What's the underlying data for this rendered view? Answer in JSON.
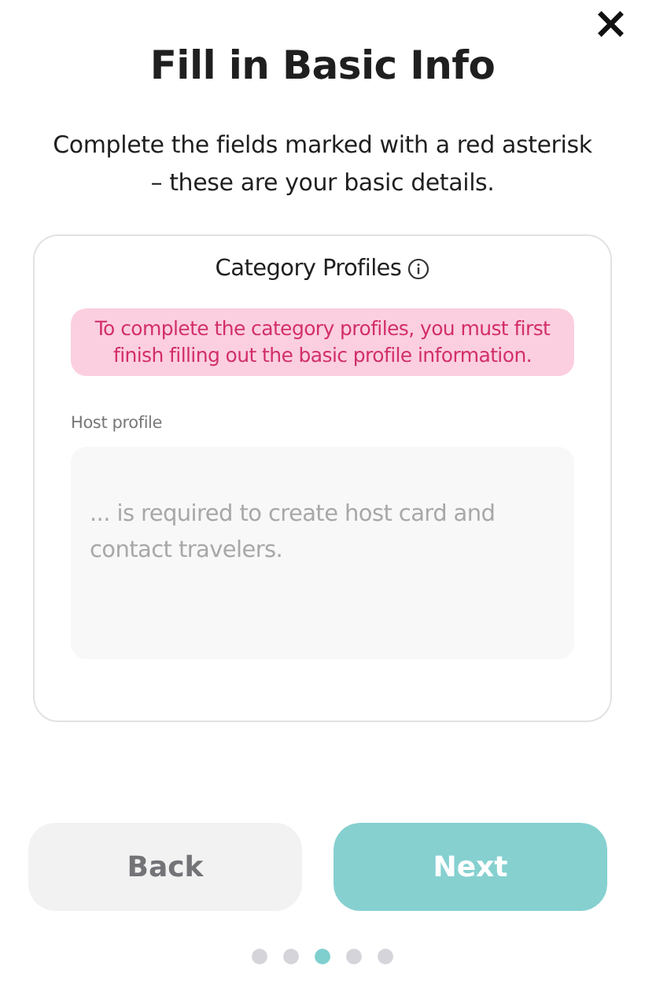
{
  "close": {
    "label": "×"
  },
  "title": "Fill in Basic Info",
  "subtitle": "Complete the fields marked with a red asterisk – these are your basic details.",
  "card": {
    "title": "Category Profiles",
    "alert": "To complete the category profiles, you must first finish filling out the basic profile information.",
    "field": {
      "label": "Host profile",
      "placeholder": "... is required to create host card and contact travelers."
    }
  },
  "buttons": [
    {
      "kind": "secondary",
      "label": "Back",
      "disabled": false
    },
    {
      "kind": "primary",
      "label": "Next",
      "disabled": true
    }
  ],
  "steps": [
    {
      "selected": false
    },
    {
      "selected": false
    },
    {
      "selected": true
    },
    {
      "selected": false
    },
    {
      "selected": false
    }
  ]
}
